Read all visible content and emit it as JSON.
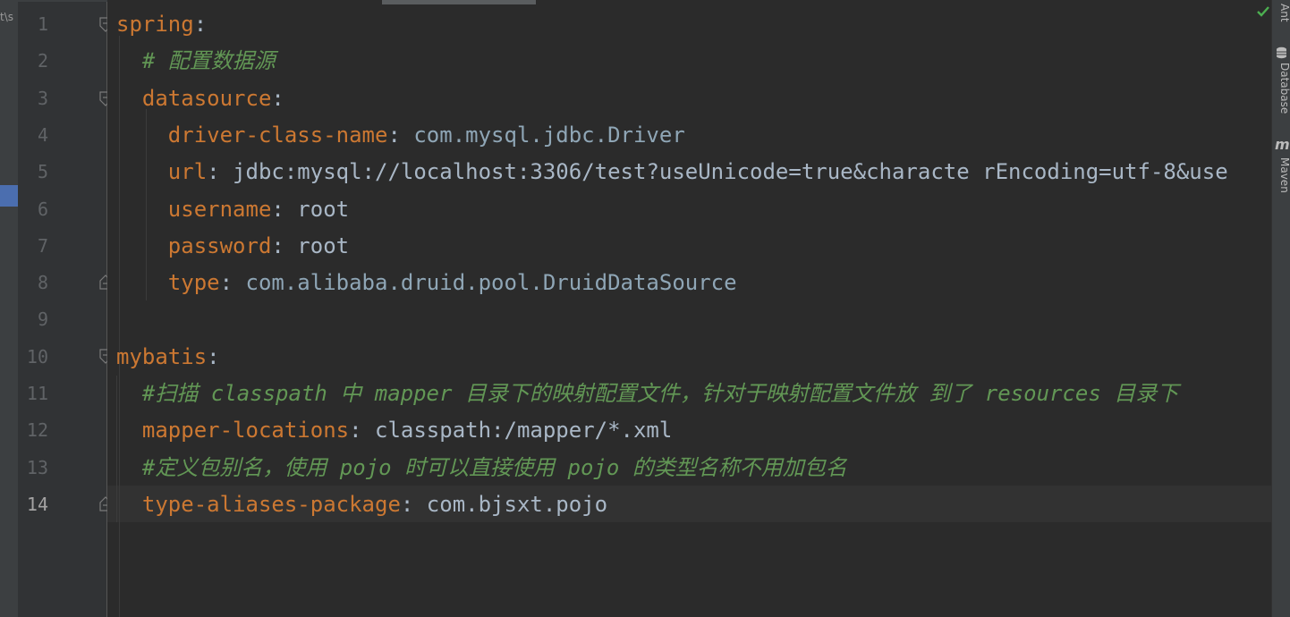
{
  "left_panel": {
    "path_text": "t\\s"
  },
  "right_tabs": [
    {
      "label": "Ant"
    },
    {
      "label": "Database"
    },
    {
      "label": "Maven",
      "icon_text": "m"
    }
  ],
  "inspection_status": {
    "icon": "check-icon",
    "color": "#4caf50"
  },
  "editor": {
    "active_line": "14",
    "lines": [
      {
        "num": "1",
        "t": [
          [
            "k",
            "spring"
          ],
          [
            "p",
            ":"
          ]
        ]
      },
      {
        "num": "2",
        "t": [
          [
            "s",
            "  "
          ],
          [
            "c",
            "# 配置数据源"
          ]
        ]
      },
      {
        "num": "3",
        "t": [
          [
            "s",
            "  "
          ],
          [
            "k",
            "datasource"
          ],
          [
            "p",
            ":"
          ]
        ]
      },
      {
        "num": "4",
        "t": [
          [
            "s",
            "    "
          ],
          [
            "k",
            "driver-class-name"
          ],
          [
            "p",
            ": "
          ],
          [
            "vcls",
            "com.mysql.jdbc.Driver"
          ]
        ]
      },
      {
        "num": "5",
        "t": [
          [
            "s",
            "    "
          ],
          [
            "k",
            "url"
          ],
          [
            "p",
            ": "
          ],
          [
            "v",
            "jdbc:mysql://localhost:3306/test?useUnicode=true&characte rEncoding=utf-8&use"
          ]
        ]
      },
      {
        "num": "6",
        "t": [
          [
            "s",
            "    "
          ],
          [
            "k",
            "username"
          ],
          [
            "p",
            ": "
          ],
          [
            "v",
            "root"
          ]
        ]
      },
      {
        "num": "7",
        "t": [
          [
            "s",
            "    "
          ],
          [
            "k",
            "password"
          ],
          [
            "p",
            ": "
          ],
          [
            "v",
            "root"
          ]
        ]
      },
      {
        "num": "8",
        "t": [
          [
            "s",
            "    "
          ],
          [
            "k",
            "type"
          ],
          [
            "p",
            ": "
          ],
          [
            "vcls",
            "com.alibaba.druid.pool.DruidDataSource"
          ]
        ]
      },
      {
        "num": "9",
        "t": []
      },
      {
        "num": "10",
        "t": [
          [
            "k",
            "mybatis"
          ],
          [
            "p",
            ":"
          ]
        ]
      },
      {
        "num": "11",
        "t": [
          [
            "s",
            "  "
          ],
          [
            "c",
            "#扫描 classpath 中 mapper 目录下的映射配置文件，针对于映射配置文件放 到了 resources 目录下"
          ]
        ]
      },
      {
        "num": "12",
        "t": [
          [
            "s",
            "  "
          ],
          [
            "k",
            "mapper-locations"
          ],
          [
            "p",
            ": "
          ],
          [
            "v",
            "classpath:/mapper/*.xml"
          ]
        ]
      },
      {
        "num": "13",
        "t": [
          [
            "s",
            "  "
          ],
          [
            "c",
            "#定义包别名，使用 pojo 时可以直接使用 pojo 的类型名称不用加包名"
          ]
        ]
      },
      {
        "num": "14",
        "t": [
          [
            "s",
            "  "
          ],
          [
            "k",
            "type-aliases-package"
          ],
          [
            "p",
            ": "
          ],
          [
            "v",
            "com.bjsxt.pojo"
          ]
        ]
      }
    ]
  },
  "colors": {
    "background": "#2b2b2b",
    "gutter": "#313335",
    "key": "#cc7832",
    "comment": "#629755",
    "value": "#a9b7c6",
    "line_number": "#606366"
  }
}
